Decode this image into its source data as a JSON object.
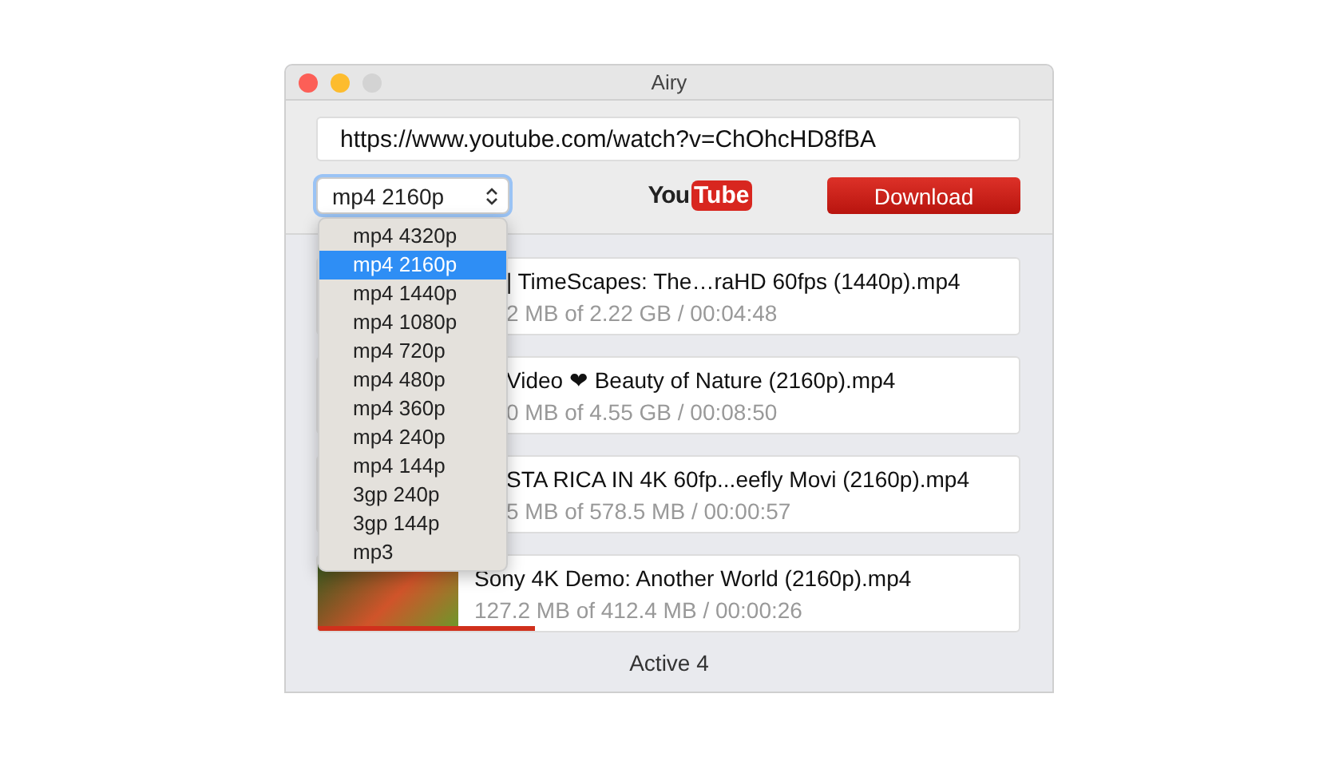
{
  "window": {
    "title": "Airy"
  },
  "url_field": {
    "value": "https://www.youtube.com/watch?v=ChOhcHD8fBA"
  },
  "format_select": {
    "value": "mp4 2160p",
    "expanded": true
  },
  "format_menu": [
    {
      "label": "mp4 4320p",
      "selected": false
    },
    {
      "label": "mp4 2160p",
      "selected": true
    },
    {
      "label": "mp4 1440p",
      "selected": false
    },
    {
      "label": "mp4 1080p",
      "selected": false
    },
    {
      "label": "mp4 720p",
      "selected": false
    },
    {
      "label": "mp4 480p",
      "selected": false
    },
    {
      "label": "mp4 360p",
      "selected": false
    },
    {
      "label": "mp4 240p",
      "selected": false
    },
    {
      "label": "mp4 144p",
      "selected": false
    },
    {
      "label": "3gp 240p",
      "selected": false
    },
    {
      "label": "3gp 144p",
      "selected": false
    },
    {
      "label": "mp3",
      "selected": false
    }
  ],
  "logo": {
    "you": "You",
    "tube": "Tube"
  },
  "download_button": "Download",
  "downloads": [
    {
      "title": "|  TimeScapes: The…raHD 60fps (1440p).mp4",
      "progress": "2 MB of 2.22 GB / 00:04:48",
      "covered": true
    },
    {
      "title": "Video ❤ Beauty of Nature (2160p).mp4",
      "progress": "0 MB of 4.55 GB / 00:08:50",
      "covered": true
    },
    {
      "title": "STA RICA IN 4K 60fp...eefly Movi (2160p).mp4",
      "progress": "5 MB of 578.5 MB / 00:00:57",
      "covered": true
    },
    {
      "title": "Sony 4K Demo: Another World (2160p).mp4",
      "progress": "127.2 MB of 412.4 MB / 00:00:26",
      "covered": false,
      "level": 0.31
    }
  ],
  "status_bar": "Active 4"
}
